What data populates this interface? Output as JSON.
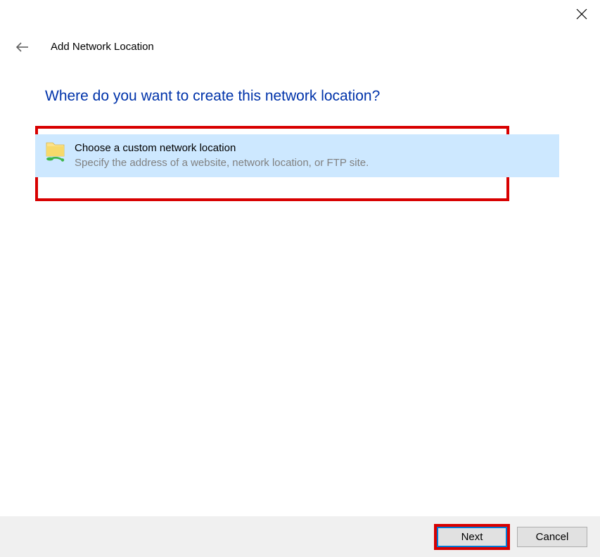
{
  "titlebar": {
    "close_label": "Close"
  },
  "header": {
    "back_label": "Back",
    "title": "Add Network Location"
  },
  "content": {
    "heading": "Where do you want to create this network location?",
    "option": {
      "title": "Choose a custom network location",
      "description": "Specify the address of a website, network location, or FTP site."
    }
  },
  "footer": {
    "next_label": "Next",
    "cancel_label": "Cancel"
  }
}
